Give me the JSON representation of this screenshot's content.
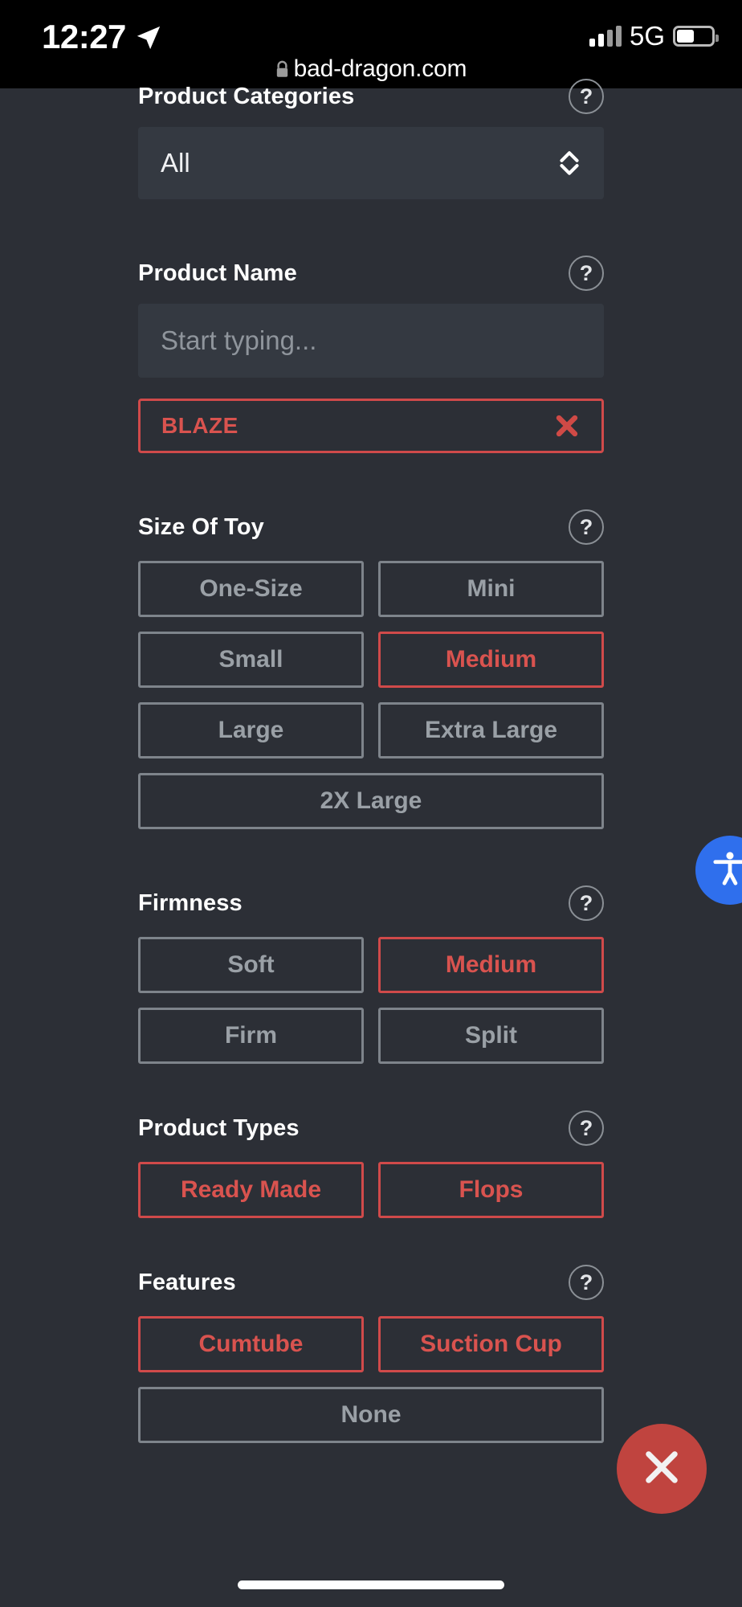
{
  "status_bar": {
    "time": "12:27",
    "location_icon": "location-arrow-icon",
    "signal_icon": "cellular-signal-icon",
    "network": "5G",
    "battery_icon": "battery-icon"
  },
  "browser": {
    "lock_icon": "lock-icon",
    "url": "bad-dragon.com"
  },
  "filters": {
    "product_categories": {
      "title": "Product Categories",
      "help_label": "?",
      "selected": "All",
      "chevron_icon": "chevron-updown-icon"
    },
    "product_name": {
      "title": "Product Name",
      "help_label": "?",
      "placeholder": "Start typing...",
      "value": "",
      "chips": [
        {
          "label": "BLAZE",
          "remove_icon": "close-x-icon"
        }
      ]
    },
    "size_of_toy": {
      "title": "Size Of Toy",
      "help_label": "?",
      "options": [
        {
          "label": "One-Size",
          "selected": false,
          "full": false
        },
        {
          "label": "Mini",
          "selected": false,
          "full": false
        },
        {
          "label": "Small",
          "selected": false,
          "full": false
        },
        {
          "label": "Medium",
          "selected": true,
          "full": false
        },
        {
          "label": "Large",
          "selected": false,
          "full": false
        },
        {
          "label": "Extra Large",
          "selected": false,
          "full": false
        },
        {
          "label": "2X Large",
          "selected": false,
          "full": true
        }
      ]
    },
    "firmness": {
      "title": "Firmness",
      "help_label": "?",
      "options": [
        {
          "label": "Soft",
          "selected": false,
          "full": false
        },
        {
          "label": "Medium",
          "selected": true,
          "full": false
        },
        {
          "label": "Firm",
          "selected": false,
          "full": false
        },
        {
          "label": "Split",
          "selected": false,
          "full": false
        }
      ]
    },
    "product_types": {
      "title": "Product Types",
      "help_label": "?",
      "options": [
        {
          "label": "Ready Made",
          "selected": true,
          "full": false
        },
        {
          "label": "Flops",
          "selected": true,
          "full": false
        }
      ]
    },
    "features": {
      "title": "Features",
      "help_label": "?",
      "options": [
        {
          "label": "Cumtube",
          "selected": true,
          "full": false
        },
        {
          "label": "Suction Cup",
          "selected": true,
          "full": false
        },
        {
          "label": "None",
          "selected": false,
          "full": true
        }
      ]
    }
  },
  "floating": {
    "accessibility_icon": "accessibility-person-icon",
    "close_icon": "close-x-icon"
  },
  "colors": {
    "accent_red": "#d9534f",
    "border_red": "#d04a4a",
    "page_bg": "#2c2f36",
    "field_bg": "#343941",
    "border_gray": "#7e848b",
    "text_gray": "#9aa0a6",
    "a11y_blue": "#2f6fed",
    "fab_red": "#c0443f"
  }
}
